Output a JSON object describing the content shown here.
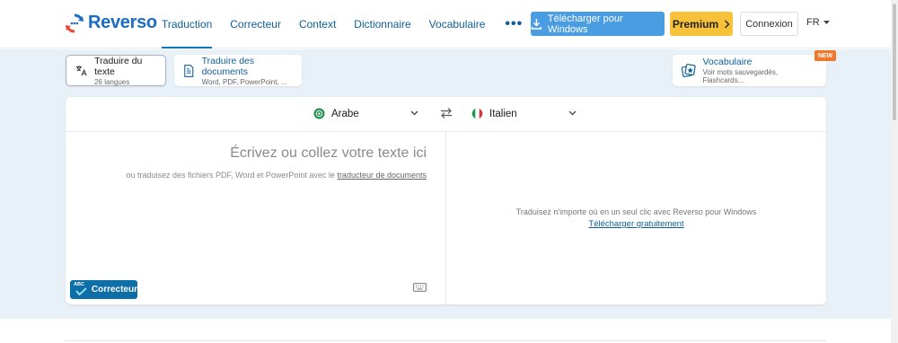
{
  "header": {
    "logo_text": "Reverso",
    "nav": [
      {
        "label": "Traduction",
        "active": true
      },
      {
        "label": "Correcteur",
        "active": false
      },
      {
        "label": "Context",
        "active": false
      },
      {
        "label": "Dictionnaire",
        "active": false
      },
      {
        "label": "Vocabulaire",
        "active": false
      }
    ],
    "more": "•••",
    "download_label": "Télécharger pour Windows",
    "premium_label": "Premium",
    "login_label": "Connexion",
    "lang_label": "FR"
  },
  "modes": {
    "text": {
      "title": "Traduire du texte",
      "sub": "26 langues"
    },
    "docs": {
      "title": "Traduire des documents",
      "sub": "Word, PDF, PowerPoint, ..."
    },
    "vocab": {
      "title": "Vocabulaire",
      "sub": "Voir mots sauvegardés, Flashcards...",
      "badge": "NEW"
    }
  },
  "translator": {
    "source_lang": "Arabe",
    "target_lang": "Italien",
    "placeholder": "Écrivez ou collez votre texte ici",
    "hint_prefix": "ou traduisez des fichiers PDF, Word et PowerPoint avec le ",
    "hint_link": "traducteur de documents",
    "right_message": "Traduisez n'importe où en un seul clic avec Reverso pour Windows",
    "right_link": "Télécharger gratuitement",
    "corrector_label": "Correcteur",
    "corrector_badge": "ABC"
  },
  "colors": {
    "brand": "#1b6ec2",
    "premium": "#f7c23a",
    "download": "#4a9de1",
    "new_badge": "#f0782d"
  }
}
